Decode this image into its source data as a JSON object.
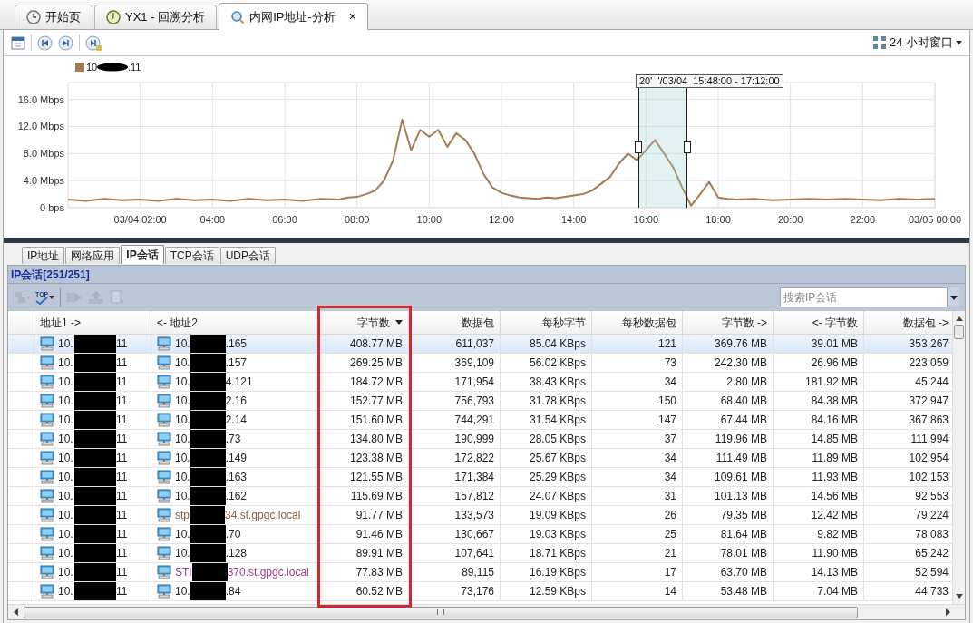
{
  "tabs": [
    {
      "label": "开始页",
      "kind": "start",
      "selected": false
    },
    {
      "label": "YX1 - 回溯分析",
      "kind": "replay",
      "selected": false
    },
    {
      "label": "内网IP地址-分析",
      "kind": "analysis",
      "selected": true,
      "close": "×"
    }
  ],
  "time_window": {
    "label": "24 小时窗口"
  },
  "chart": {
    "legend_tail": ".11",
    "selection": {
      "label": "20'  '/03/04  15:48:00 - 17:12:00"
    },
    "chart_data": {
      "type": "line",
      "grid": true,
      "x": [
        0,
        0.5,
        1,
        1.5,
        2,
        2.5,
        3,
        3.5,
        4,
        4.5,
        5,
        5.5,
        6,
        6.5,
        7,
        7.5,
        7.75,
        8,
        8.25,
        8.5,
        8.75,
        9,
        9.25,
        9.5,
        9.75,
        10,
        10.25,
        10.5,
        10.75,
        11,
        11.25,
        11.5,
        11.75,
        12,
        12.25,
        12.5,
        12.75,
        13,
        13.25,
        13.5,
        13.75,
        14,
        14.25,
        14.5,
        14.75,
        15,
        15.25,
        15.5,
        15.75,
        16,
        16.25,
        16.5,
        16.75,
        17,
        17.25,
        17.5,
        17.75,
        18,
        18.25,
        18.5,
        19,
        19.5,
        20,
        20.5,
        21,
        21.5,
        22,
        22.5,
        23,
        23.5,
        24
      ],
      "series": [
        {
          "name": "10",
          "color": "#a57c52",
          "values": [
            1.2,
            1.0,
            1.3,
            1.1,
            1.2,
            1.0,
            1.3,
            1.1,
            1.2,
            1.0,
            1.3,
            1.1,
            1.2,
            1.0,
            1.3,
            1.2,
            1.5,
            1.6,
            2.0,
            2.5,
            4.0,
            7.0,
            13.0,
            8.5,
            11.5,
            10.5,
            11.5,
            9.0,
            11.0,
            10.0,
            8.0,
            5.0,
            3.0,
            2.2,
            1.8,
            1.5,
            1.4,
            1.3,
            1.5,
            1.4,
            1.6,
            1.8,
            2.0,
            2.5,
            3.5,
            4.5,
            6.5,
            8.0,
            7.0,
            8.5,
            10.0,
            8.0,
            6.0,
            3.0,
            0.3,
            2.0,
            3.8,
            1.5,
            1.3,
            1.2,
            1.3,
            1.1,
            1.2,
            1.3,
            1.2,
            1.3,
            1.2,
            1.1,
            1.3,
            1.2,
            1.3
          ]
        }
      ],
      "xlim": [
        0,
        24
      ],
      "ylim": [
        0,
        18.5
      ],
      "xticks": [
        {
          "value": 2,
          "label": "03/04 02:00"
        },
        {
          "value": 4,
          "label": "04:00"
        },
        {
          "value": 6,
          "label": "06:00"
        },
        {
          "value": 8,
          "label": "08:00"
        },
        {
          "value": 10,
          "label": "10:00"
        },
        {
          "value": 12,
          "label": "12:00"
        },
        {
          "value": 14,
          "label": "14:00"
        },
        {
          "value": 16,
          "label": "16:00"
        },
        {
          "value": 18,
          "label": "18:00"
        },
        {
          "value": 20,
          "label": "20:00"
        },
        {
          "value": 22,
          "label": "22:00"
        },
        {
          "value": 24,
          "label": "03/05 00:00"
        }
      ],
      "yticks": [
        {
          "value": 0,
          "label": "0 bps"
        },
        {
          "value": 4,
          "label": "4.0 Mbps"
        },
        {
          "value": 8,
          "label": "8.0 Mbps"
        },
        {
          "value": 12,
          "label": "12.0 Mbps"
        },
        {
          "value": 16,
          "label": "16.0 Mbps"
        }
      ]
    }
  },
  "sub_tabs": [
    {
      "label": "IP地址",
      "selected": false
    },
    {
      "label": "网络应用",
      "selected": false
    },
    {
      "label": "IP会话",
      "selected": true
    },
    {
      "label": "TCP会话",
      "selected": false
    },
    {
      "label": "UDP会话",
      "selected": false
    }
  ],
  "panel": {
    "title": "IP会话[251/251]",
    "search": {
      "placeholder": "搜索IP会话"
    },
    "toolbar": [
      {
        "kind": "hosts",
        "disabled": true
      },
      {
        "kind": "top",
        "label": "TOP",
        "disabled": false
      },
      {
        "kind": "forward",
        "disabled": true
      },
      {
        "kind": "upload",
        "disabled": true
      },
      {
        "kind": "report",
        "disabled": true
      }
    ]
  },
  "table": {
    "columns": [
      {
        "label": "地址1 ->",
        "sorted_descending": false,
        "highlighted": false
      },
      {
        "label": "<- 地址2",
        "sorted_descending": false,
        "highlighted": false
      },
      {
        "label": "字节数",
        "sorted_descending": true,
        "highlighted": true
      },
      {
        "label": "数据包",
        "sorted_descending": false,
        "highlighted": false
      },
      {
        "label": "每秒字节",
        "sorted_descending": false,
        "highlighted": false
      },
      {
        "label": "每秒数据包",
        "sorted_descending": false,
        "highlighted": false
      },
      {
        "label": "字节数 ->",
        "sorted_descending": false,
        "highlighted": false
      },
      {
        "label": "<- 字节数",
        "sorted_descending": false,
        "highlighted": false
      },
      {
        "label": "数据包 ->",
        "sorted_descending": false,
        "highlighted": false
      }
    ],
    "rows": [
      {
        "selected": true,
        "cells": [
          {
            "head": "10.",
            "tail": "11"
          },
          {
            "head": "10.",
            "tail": ".165"
          },
          "408.77 MB",
          "611,037",
          "85.04 KBps",
          "121",
          "369.76 MB",
          "39.01 MB",
          "353,267"
        ]
      },
      {
        "selected": false,
        "cells": [
          {
            "head": "10.",
            "tail": "11"
          },
          {
            "head": "10.",
            "tail": ".157"
          },
          "269.25 MB",
          "369,109",
          "56.02 KBps",
          "73",
          "242.30 MB",
          "26.96 MB",
          "223,059"
        ]
      },
      {
        "selected": false,
        "cells": [
          {
            "head": "10.",
            "tail": "11"
          },
          {
            "head": "10.",
            "tail": "4.121"
          },
          "184.72 MB",
          "171,954",
          "38.43 KBps",
          "34",
          "2.80 MB",
          "181.92 MB",
          "45,244"
        ]
      },
      {
        "selected": false,
        "cells": [
          {
            "head": "10.",
            "tail": "11"
          },
          {
            "head": "10.",
            "tail": "2.16"
          },
          "152.77 MB",
          "756,793",
          "31.78 KBps",
          "150",
          "68.40 MB",
          "84.38 MB",
          "372,947"
        ]
      },
      {
        "selected": false,
        "cells": [
          {
            "head": "10.",
            "tail": "11"
          },
          {
            "head": "10.",
            "tail": "2.14"
          },
          "151.60 MB",
          "744,291",
          "31.54 KBps",
          "147",
          "67.44 MB",
          "84.16 MB",
          "367,863"
        ]
      },
      {
        "selected": false,
        "cells": [
          {
            "head": "10.",
            "tail": "11"
          },
          {
            "head": "10.",
            "tail": ".73"
          },
          "134.80 MB",
          "190,999",
          "28.05 KBps",
          "37",
          "119.96 MB",
          "14.85 MB",
          "111,994"
        ]
      },
      {
        "selected": false,
        "cells": [
          {
            "head": "10.",
            "tail": "11"
          },
          {
            "head": "10.",
            "tail": ".149"
          },
          "123.38 MB",
          "172,822",
          "25.67 KBps",
          "34",
          "111.49 MB",
          "11.89 MB",
          "102,954"
        ]
      },
      {
        "selected": false,
        "cells": [
          {
            "head": "10.",
            "tail": "11"
          },
          {
            "head": "10.",
            "tail": ".163"
          },
          "121.55 MB",
          "171,384",
          "25.29 KBps",
          "34",
          "109.61 MB",
          "11.93 MB",
          "102,153"
        ]
      },
      {
        "selected": false,
        "cells": [
          {
            "head": "10.",
            "tail": "11"
          },
          {
            "head": "10.",
            "tail": ".162"
          },
          "115.69 MB",
          "157,812",
          "24.07 KBps",
          "31",
          "101.13 MB",
          "14.56 MB",
          "92,553"
        ]
      },
      {
        "selected": false,
        "cells": [
          {
            "head": "10.",
            "tail": "11"
          },
          {
            "head": "stp",
            "tail": "34.st.gpgc.local",
            "color": "#8b5e3c"
          },
          "91.77 MB",
          "133,573",
          "19.09 KBps",
          "26",
          "79.35 MB",
          "12.42 MB",
          "79,224"
        ]
      },
      {
        "selected": false,
        "cells": [
          {
            "head": "10.",
            "tail": "11"
          },
          {
            "head": "10.",
            "tail": ".70"
          },
          "91.46 MB",
          "130,667",
          "19.03 KBps",
          "25",
          "81.64 MB",
          "9.82 MB",
          "78,083"
        ]
      },
      {
        "selected": false,
        "cells": [
          {
            "head": "10.",
            "tail": "11"
          },
          {
            "head": "10.",
            "tail": ".128"
          },
          "89.91 MB",
          "107,641",
          "18.71 KBps",
          "21",
          "78.01 MB",
          "11.90 MB",
          "65,242"
        ]
      },
      {
        "selected": false,
        "cells": [
          {
            "head": "10.",
            "tail": "11"
          },
          {
            "head": "STI",
            "tail": "370.st.gpgc.local",
            "color": "#9c3b8c"
          },
          "77.83 MB",
          "89,115",
          "16.19 KBps",
          "17",
          "63.70 MB",
          "14.13 MB",
          "52,594"
        ]
      },
      {
        "selected": false,
        "cells": [
          {
            "head": "10.",
            "tail": "11"
          },
          {
            "head": "10.",
            "tail": ".84"
          },
          "60.52 MB",
          "73,176",
          "12.59 KBps",
          "14",
          "53.48 MB",
          "7.04 MB",
          "44,733"
        ]
      }
    ]
  }
}
